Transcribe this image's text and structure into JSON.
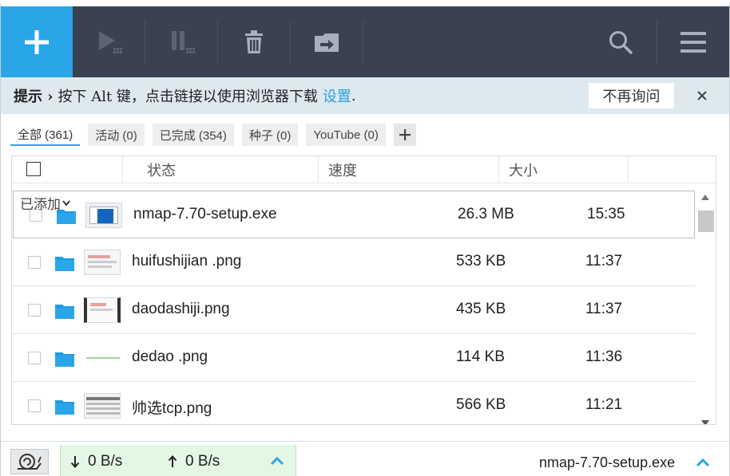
{
  "app": {
    "accent": "#2aa6e8",
    "toolbar_bg": "#3a4150"
  },
  "toolbar": {
    "add": "plus-icon",
    "start": "play-icon",
    "pause": "pause-icon",
    "delete": "trash-icon",
    "move": "move-to-icon",
    "search": "search-icon",
    "menu": "hamburger-menu-icon"
  },
  "notice": {
    "bold": "提示 ›",
    "text": "按下 Alt 键，点击链接以使用浏览器下载",
    "link": "设置",
    "period": ".",
    "never_ask": "不再询问",
    "close": "close-icon"
  },
  "tabs": [
    {
      "label": "全部 (361)"
    },
    {
      "label": "活动 (0)"
    },
    {
      "label": "已完成 (354)"
    },
    {
      "label": "种子 (0)"
    },
    {
      "label": "YouTube (0)"
    }
  ],
  "table": {
    "columns": {
      "status": "状态",
      "speed": "速度",
      "size": "大小"
    },
    "sort_label": "已添加",
    "rows": [
      {
        "name": "nmap-7.70-setup.exe",
        "size": "26.3 MB",
        "time": "15:35"
      },
      {
        "name": "huifushijian .png",
        "size": "533 KB",
        "time": "11:37"
      },
      {
        "name": "daodashiji.png",
        "size": "435 KB",
        "time": "11:37"
      },
      {
        "name": "dedao .png",
        "size": "114 KB",
        "time": "11:36"
      },
      {
        "name": "帅选tcp.png",
        "size": "566 KB",
        "time": "11:21"
      }
    ]
  },
  "statusbar": {
    "down_speed": "0 B/s",
    "up_speed": "0 B/s",
    "current_file": "nmap-7.70-setup.exe",
    "speed_accent": "#37c24a"
  }
}
